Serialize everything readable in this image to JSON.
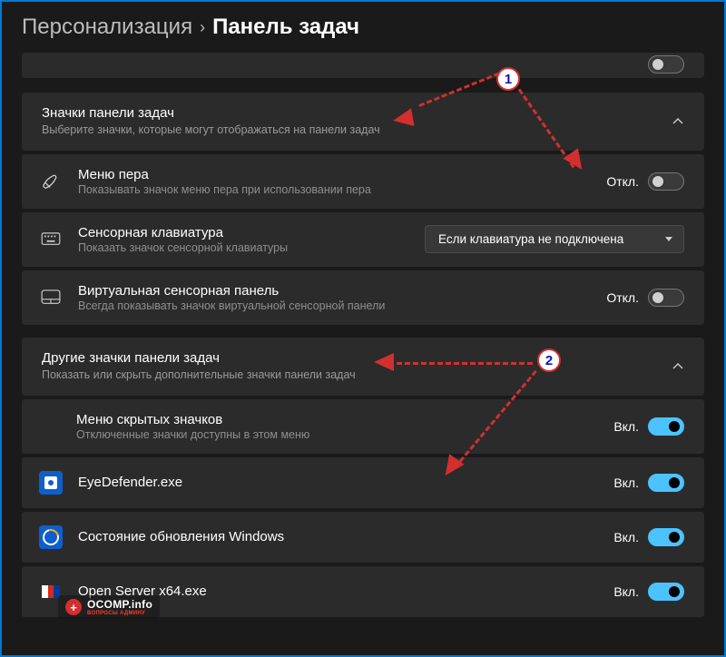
{
  "breadcrumb": {
    "parent": "Персонализация",
    "current": "Панель задач"
  },
  "section_icons": {
    "title": "Значки панели задач",
    "subtitle": "Выберите значки, которые могут отображаться на панели задач",
    "items": [
      {
        "title": "Меню пера",
        "sub": "Показывать значок меню пера при использовании пера",
        "state": "Откл.",
        "on": false,
        "icon": "pen"
      },
      {
        "title": "Сенсорная клавиатура",
        "sub": "Показать значок сенсорной клавиатуры",
        "dropdown": "Если клавиатура не подключена",
        "icon": "keyboard"
      },
      {
        "title": "Виртуальная сенсорная панель",
        "sub": "Всегда показывать значок виртуальной сенсорной панели",
        "state": "Откл.",
        "on": false,
        "icon": "touchpad"
      }
    ]
  },
  "section_other": {
    "title": "Другие значки панели задач",
    "subtitle": "Показать или скрыть дополнительные значки панели задач",
    "items": [
      {
        "title": "Меню скрытых значков",
        "sub": "Отключенные значки доступны в этом меню",
        "state": "Вкл.",
        "on": true
      },
      {
        "title": "EyeDefender.exe",
        "state": "Вкл.",
        "on": true,
        "app": "eye"
      },
      {
        "title": "Состояние обновления Windows",
        "state": "Вкл.",
        "on": true,
        "app": "wu"
      },
      {
        "title": "Open Server x64.exe",
        "state": "Вкл.",
        "on": true,
        "app": "os"
      }
    ]
  },
  "annotations": {
    "badge1": "1",
    "badge2": "2"
  },
  "watermark": {
    "logo": "+",
    "main": "OCOMP.info",
    "sub": "ВОПРОСЫ АДМИНУ"
  }
}
